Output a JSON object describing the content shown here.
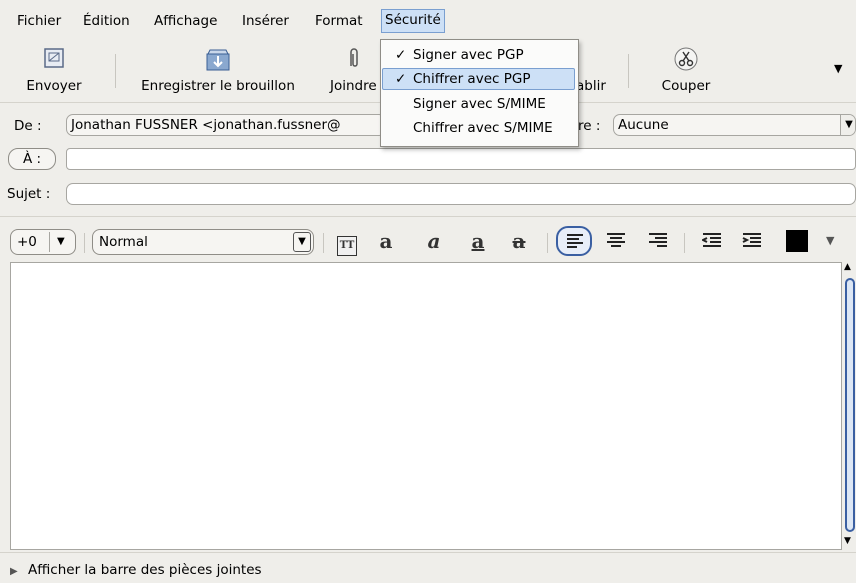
{
  "menubar": {
    "items": [
      {
        "label": "Fichier"
      },
      {
        "label": "Édition"
      },
      {
        "label": "Affichage"
      },
      {
        "label": "Insérer"
      },
      {
        "label": "Format"
      },
      {
        "label": "Sécurité"
      }
    ]
  },
  "toolbar": {
    "send_label": "Envoyer",
    "save_draft_label": "Enregistrer le brouillon",
    "attach_label": "Joindre",
    "establish_label": "ablir",
    "cut_label": "Couper"
  },
  "header": {
    "from_label": "De :",
    "from_value": "Jonathan FUSSNER <jonathan.fussner@",
    "recipient_type_label": "À :",
    "recipient_value": "",
    "subject_label": "Sujet :",
    "subject_value": "",
    "priority_label_partial": "re :",
    "priority_value": "Aucune"
  },
  "format_bar": {
    "font_size_value": "+0",
    "paragraph_style_value": "Normal",
    "color_swatch": "#000000"
  },
  "security_menu": {
    "items": [
      {
        "check": "✓",
        "label": "Signer avec PGP",
        "highlighted": false
      },
      {
        "check": "✓",
        "label": "Chiffrer avec PGP",
        "highlighted": true
      },
      {
        "check": "",
        "label": "Signer avec S/MIME",
        "highlighted": false
      },
      {
        "check": "",
        "label": "Chiffrer avec S/MIME",
        "highlighted": false
      }
    ]
  },
  "attachments_bar": {
    "label": "Afficher la barre des pièces jointes"
  },
  "colors": {
    "highlight_bg": "#cde0f6",
    "highlight_border": "#7a9fd0",
    "window_bg": "#efeeea"
  }
}
